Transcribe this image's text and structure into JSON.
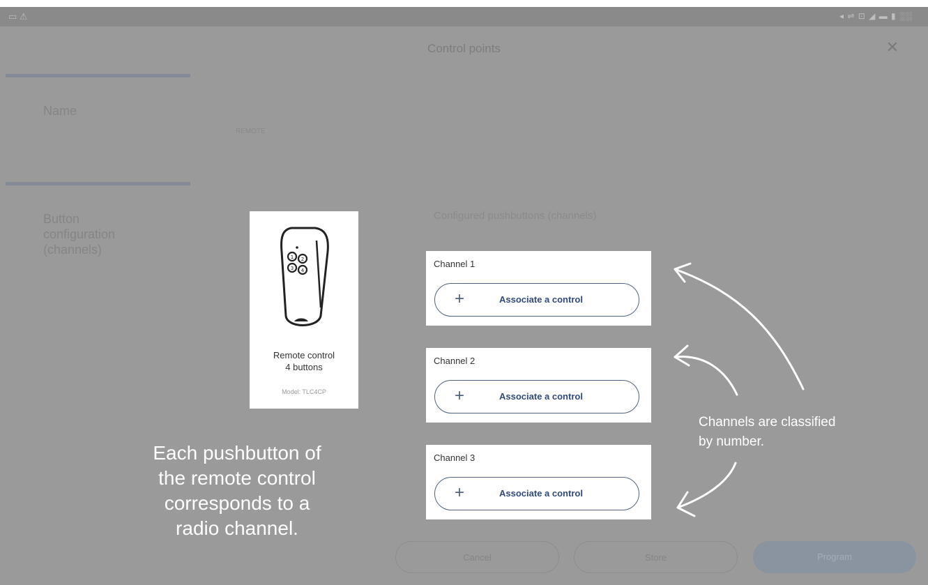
{
  "status_bar": {
    "left_icons": "▭ ⚠",
    "right_icons": "◂ ⇌ ⊡ ◢ ▬ ▮ ░░"
  },
  "header": {
    "title": "Control points",
    "close_icon": "close-icon"
  },
  "form": {
    "name_label": "Name",
    "name_value": "REMOTE",
    "button_config_label": [
      "Button",
      "configuration",
      "(channels)"
    ]
  },
  "remote": {
    "name_line1": "Remote control",
    "name_line2": "4 buttons",
    "model": "Model: TLC4CP",
    "button_numbers": [
      "1",
      "2",
      "3",
      "4"
    ]
  },
  "channels": {
    "title": "Configured pushbuttons (channels)",
    "items": [
      {
        "label": "Channel 1",
        "action": "Associate a control"
      },
      {
        "label": "Channel 2",
        "action": "Associate a control"
      },
      {
        "label": "Channel 3",
        "action": "Associate a control"
      }
    ],
    "plus_symbol": "+"
  },
  "footer": {
    "cancel": "Cancel",
    "store": "Store",
    "program": "Program"
  },
  "annotations": {
    "left": [
      "Each pushbutton of",
      "the remote control",
      "corresponds to a",
      "radio channel."
    ],
    "right": [
      "Channels are classified",
      "by number."
    ]
  },
  "colors": {
    "overlay": "#9a9a9a",
    "accent": "#2f4a7a",
    "annotation_text": "#ffffff"
  }
}
